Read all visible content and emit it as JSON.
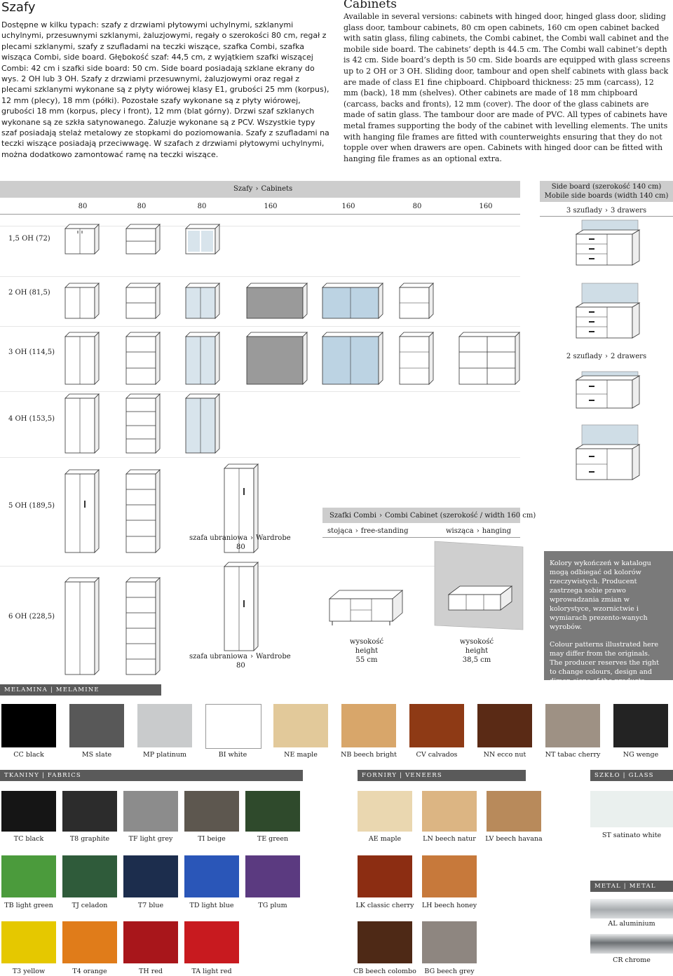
{
  "pl": {
    "title": "Szafy",
    "body": "Dostępne w kilku typach: szafy z drzwiami płytowymi uchylnymi, szklanymi uchylnymi, przesuwnymi szklanymi, żaluzjowymi, regały o szerokości 80 cm, regał z plecami szklanymi, szafy z szufladami na teczki wiszące, szafka Combi, szafka wisząca Combi, side board. Głębokość szaf: 44,5 cm, z wyjątkiem szafki wiszącej Combi: 42 cm i szafki side board: 50 cm. Side board posiadają szklane ekrany do wys. 2 OH lub 3 OH. Szafy z drzwiami przesuwnymi, żaluzjowymi oraz regał z plecami szklanymi wykonane są z płyty wiórowej klasy E1, grubości 25 mm (korpus), 12 mm (plecy), 18 mm (półki). Pozostałe szafy wykonane są z płyty wiórowej, grubości 18 mm (korpus, plecy i front), 12 mm (blat górny). Drzwi szaf szklanych wykonane są ze szkła satynowanego. Żaluzje wykonane są z PCV. Wszystkie typy szaf posiadają stelaż metalowy ze stopkami do poziomowania. Szafy z szufladami na teczki wiszące posiadają przeciwwagę. W szafach z drzwiami płytowymi uchylnymi, można dodatkowo zamontować ramę na teczki wiszące."
  },
  "en": {
    "title": "Cabinets",
    "body": "Available in several versions: cabinets with hinged door, hinged glass door, sliding glass door, tambour cabinets, 80 cm open cabinets, 160 cm open cabinet backed with satin glass, filing cabinets, the Combi cabinet, the Combi wall cabinet and the mobile side board. The cabinets’ depth is 44.5 cm. The Combi wall cabinet’s depth is 42 cm. Side board’s depth is 50 cm. Side boards are equipped with glass screens up to 2 OH or 3 OH. Sliding door, tambour and open shelf cabinets with glass back are made of class E1 fine chipboard. Chipboard thickness: 25 mm (carcass), 12 mm (back), 18 mm (shelves). Other cabinets are made of 18 mm chipboard (carcass, backs and fronts), 12 mm (cover). The door of the glass cabinets are made of satin glass. The tambour door are made of PVC. All types of cabinets have metal frames supporting the body of the cabinet with levelling elements. The units with hanging file frames are fitted with counterweights ensuring that they do not topple over when drawers are open. Cabinets with hinged door can be fitted with hanging file frames as an optional extra."
  },
  "table": {
    "header_pl": "Szafy",
    "header_en": "Cabinets",
    "widths": [
      "80",
      "80",
      "80",
      "160",
      "160",
      "80",
      "160"
    ],
    "rows": [
      "1,5 OH (72)",
      "2 OH (81,5)",
      "3 OH (114,5)",
      "4 OH (153,5)",
      "5 OH (189,5)",
      "6 OH (228,5)"
    ],
    "sideboard_title_pl": "Side board (szerokość 140 cm)",
    "sideboard_title_en": "Mobile side boards (width 140 cm)",
    "drawers3_pl": "3 szuflady",
    "drawers3_en": "3 drawers",
    "drawers2_pl": "2 szuflady",
    "drawers2_en": "2 drawers",
    "wardrobe_pl": "szafa ubraniowa",
    "wardrobe_en": "Wardrobe",
    "wardrobe_w": "80"
  },
  "combi": {
    "header_pl": "Szafki Combi",
    "header_en": "Combi Cabinet (szerokość / width 160 cm)",
    "stand_pl": "stojąca",
    "stand_en": "free-standing",
    "hang_pl": "wisząca",
    "hang_en": "hanging",
    "h_pl": "wysokość",
    "h_en": "height",
    "h1": "55 cm",
    "h2": "38,5 cm"
  },
  "note": {
    "pl": "Kolory wykończeń w katalogu mogą odbiegać od kolorów rzeczywistych. Producent zastrzega sobie prawo wprowadzania zmian w kolorystyce, wzornictwie i wymiarach prezento-wanych wyrobów.",
    "en1": "Colour patterns illustrated here may differ from the originals.",
    "en2": "The producer reserves the right to change colours, design and dimen-sions of the products presented in the catalogue."
  },
  "melamine": {
    "label": "MELAMINA  |  MELAMINE",
    "items": [
      {
        "code": "CC",
        "name": "black",
        "color": "#000000"
      },
      {
        "code": "MS",
        "name": "slate",
        "color": "#585858"
      },
      {
        "code": "MP",
        "name": "platinum",
        "color": "#c9cbcc"
      },
      {
        "code": "BI",
        "name": "white",
        "color": "#ffffff"
      },
      {
        "code": "NE",
        "name": "maple",
        "color": "#e2c99a"
      },
      {
        "code": "NB",
        "name": "beech bright",
        "color": "#d8a66a"
      },
      {
        "code": "CV",
        "name": "calvados",
        "color": "#8e3a15"
      },
      {
        "code": "NN",
        "name": "ecco nut",
        "color": "#5a2a15"
      },
      {
        "code": "NT",
        "name": "tabac cherry",
        "color": "#9e9184"
      },
      {
        "code": "NG",
        "name": "wenge",
        "color": "#232323"
      }
    ]
  },
  "fabrics": {
    "label": "TKANINY  |  FABRICS",
    "row1": [
      {
        "code": "TC",
        "name": "black",
        "color": "#151515"
      },
      {
        "code": "T8",
        "name": "graphite",
        "color": "#2c2c2c"
      },
      {
        "code": "TF",
        "name": "light grey",
        "color": "#8c8c8c"
      },
      {
        "code": "TI",
        "name": "beige",
        "color": "#5d574f"
      },
      {
        "code": "TE",
        "name": "green",
        "color": "#2f4a2c"
      }
    ],
    "row2": [
      {
        "code": "TB",
        "name": "light green",
        "color": "#4b9b3c"
      },
      {
        "code": "TJ",
        "name": "celadon",
        "color": "#2f5b3a"
      },
      {
        "code": "T7",
        "name": "blue",
        "color": "#1c2d4d"
      },
      {
        "code": "TD",
        "name": "light blue",
        "color": "#2a56b8"
      },
      {
        "code": "TG",
        "name": "plum",
        "color": "#5b3a80"
      }
    ],
    "row3": [
      {
        "code": "T3",
        "name": "yellow",
        "color": "#e5c800"
      },
      {
        "code": "T4",
        "name": "orange",
        "color": "#e07c1a"
      },
      {
        "code": "TH",
        "name": "red",
        "color": "#a8161b"
      },
      {
        "code": "TA",
        "name": "light red",
        "color": "#c81a1f"
      }
    ]
  },
  "veneers": {
    "label": "FORNIRY  |  VENEERS",
    "row1": [
      {
        "code": "AE",
        "name": "maple",
        "color": "#ead7b0"
      },
      {
        "code": "LN",
        "name": "beech natur",
        "color": "#dcb583"
      },
      {
        "code": "LV",
        "name": "beech havana",
        "color": "#b88a5b"
      }
    ],
    "row2": [
      {
        "code": "LK",
        "name": "classic cherry",
        "color": "#8c2d12"
      },
      {
        "code": "LH",
        "name": "beech honey",
        "color": "#c7793b"
      }
    ],
    "row3": [
      {
        "code": "CB",
        "name": "beech colombo",
        "color": "#4e2916"
      },
      {
        "code": "BG",
        "name": "beech grey",
        "color": "#8e8680"
      }
    ]
  },
  "glass": {
    "label": "SZKŁO  |  GLASS",
    "items": [
      {
        "code": "ST",
        "name": "satinato white",
        "color": "#eaf0ee"
      }
    ]
  },
  "metal": {
    "label": "METAL  |  METAL",
    "items": [
      {
        "code": "AL",
        "name": "aluminium",
        "color": "#bfc3c6"
      },
      {
        "code": "CR",
        "name": "chrome",
        "color": "#8a8e91"
      }
    ]
  }
}
